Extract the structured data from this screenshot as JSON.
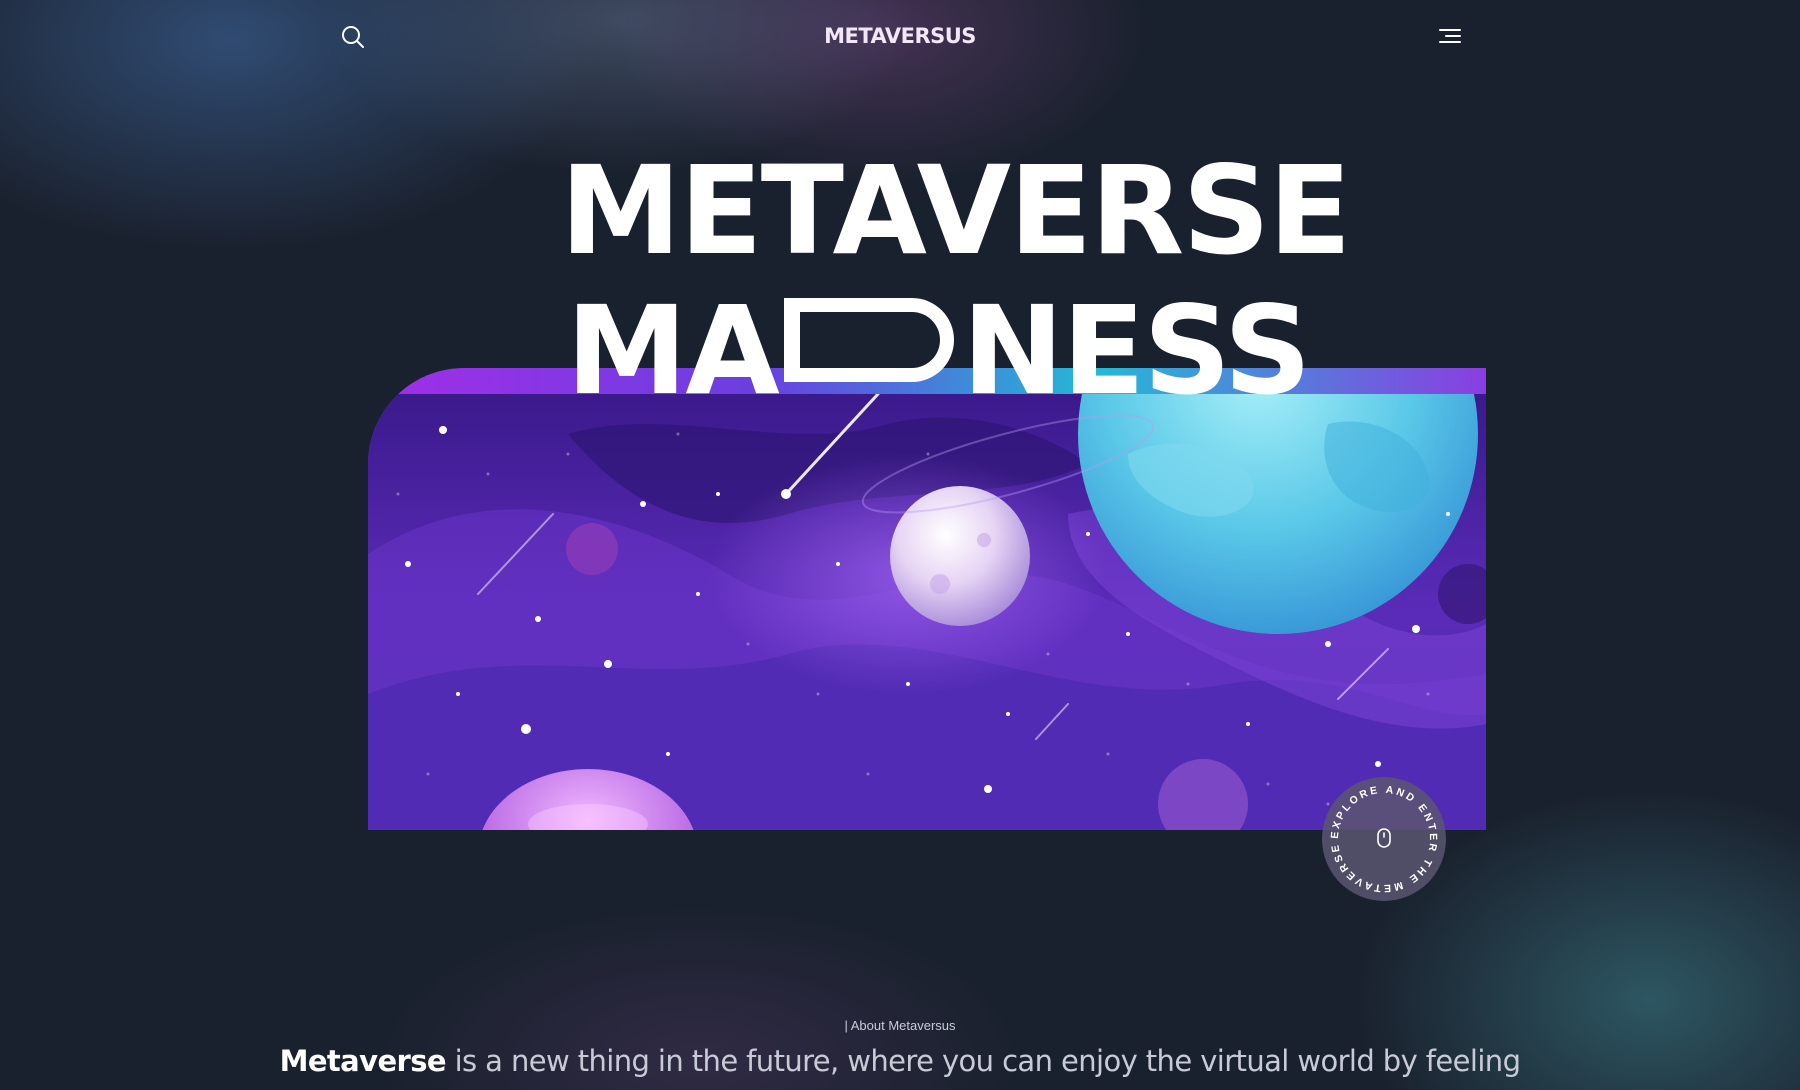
{
  "nav": {
    "logo": "METAVERSUS",
    "search_icon": "search-icon",
    "menu_icon": "menu-icon"
  },
  "hero": {
    "line1": "METAVERSE",
    "line2_before": "MA",
    "line2_after": "NESS"
  },
  "banner": {
    "alt": "space illustration"
  },
  "explore_badge": {
    "text": "EXPLORE AND ENTER THE METAVERSE",
    "icon": "mouse-icon"
  },
  "about": {
    "label": "| About Metaversus",
    "text_bold": "Metaverse",
    "text_rest": " is a new thing in the future, where you can enjoy the virtual world by feeling"
  },
  "colors": {
    "background": "#1a212e",
    "accent_purple": "#a22ee8",
    "accent_cyan": "#24b9d6"
  }
}
